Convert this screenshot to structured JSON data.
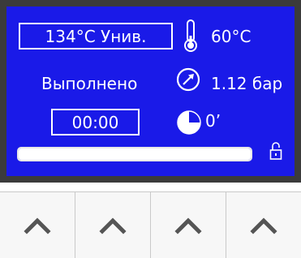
{
  "display": {
    "program_label": "134°C Унив.",
    "status_text": "Выполнено",
    "time_value": "00:00",
    "temperature": "60°C",
    "pressure": "1.12 бар",
    "elapsed": "0’",
    "progress_fraction": 1.0,
    "screen_color": "#1a1ae8",
    "text_color": "#ffffff"
  },
  "icons": {
    "thermometer": "thermometer-icon",
    "gauge": "pressure-gauge-icon",
    "pie": "pie-timer-icon",
    "lock": "unlocked-padlock-icon",
    "key": "chevron-up-icon"
  },
  "keypad": {
    "keys": [
      {
        "icon": "chevron-up-icon"
      },
      {
        "icon": "chevron-up-icon"
      },
      {
        "icon": "chevron-up-icon"
      },
      {
        "icon": "chevron-up-icon"
      }
    ]
  }
}
